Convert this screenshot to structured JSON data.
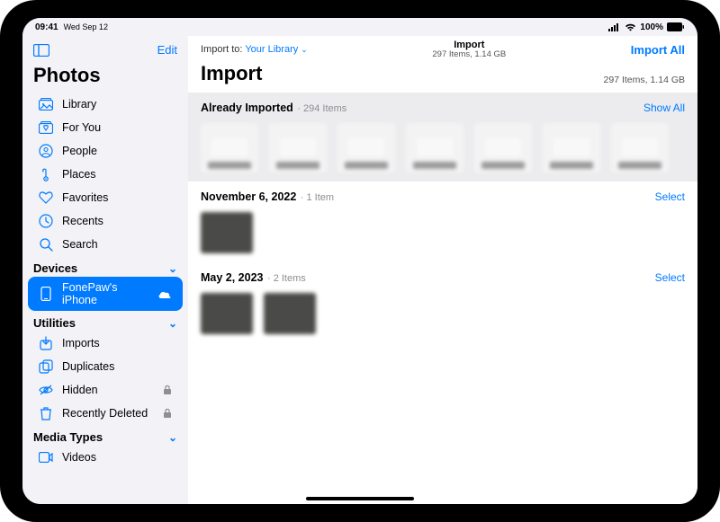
{
  "status": {
    "time": "09:41",
    "date": "Wed Sep 12",
    "battery": "100%"
  },
  "sidebar": {
    "edit": "Edit",
    "title": "Photos",
    "items": [
      {
        "label": "Library"
      },
      {
        "label": "For You"
      },
      {
        "label": "People"
      },
      {
        "label": "Places"
      },
      {
        "label": "Favorites"
      },
      {
        "label": "Recents"
      },
      {
        "label": "Search"
      }
    ],
    "devices_header": "Devices",
    "device_item": "FonePaw's iPhone",
    "utilities_header": "Utilities",
    "utilities": [
      {
        "label": "Imports"
      },
      {
        "label": "Duplicates"
      },
      {
        "label": "Hidden"
      },
      {
        "label": "Recently Deleted"
      }
    ],
    "media_header": "Media Types",
    "media": [
      {
        "label": "Videos"
      }
    ]
  },
  "main": {
    "import_to_label": "Import to:",
    "import_to_value": "Your Library",
    "center_title": "Import",
    "center_sub": "297 Items, 1.14 GB",
    "import_all": "Import All",
    "title": "Import",
    "summary": "297 Items, 1.14 GB",
    "groups": [
      {
        "title": "Already Imported",
        "sub": "294 Items",
        "action": "Show All"
      },
      {
        "title": "November 6, 2022",
        "sub": "1 Item",
        "action": "Select"
      },
      {
        "title": "May 2, 2023",
        "sub": "2 Items",
        "action": "Select"
      }
    ]
  }
}
